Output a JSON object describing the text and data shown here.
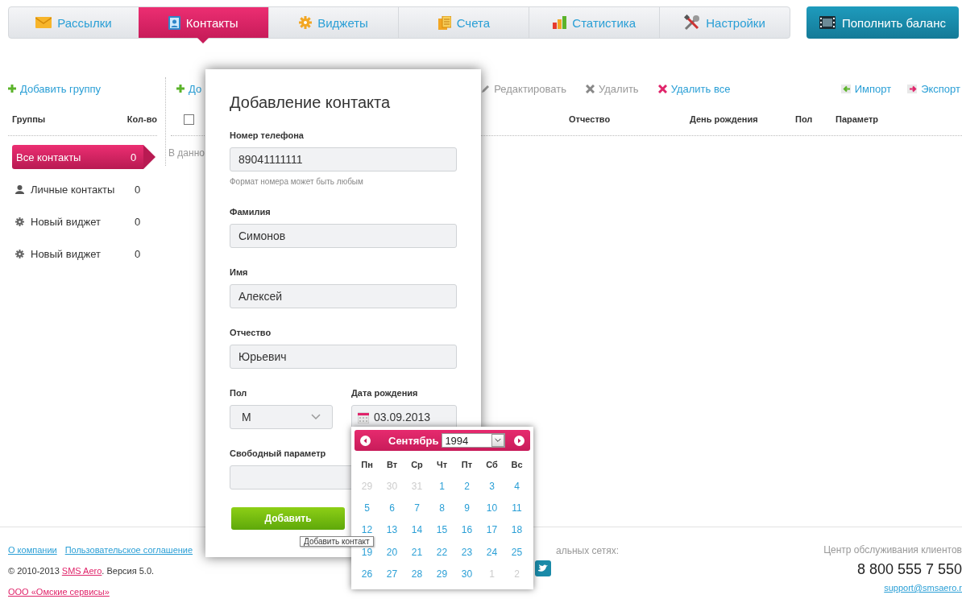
{
  "nav": {
    "tabs": [
      {
        "label": "Рассылки",
        "selected": false
      },
      {
        "label": "Контакты",
        "selected": true
      },
      {
        "label": "Виджеты",
        "selected": false
      },
      {
        "label": "Счета",
        "selected": false
      },
      {
        "label": "Статистика",
        "selected": false
      },
      {
        "label": "Настройки",
        "selected": false
      }
    ],
    "balance_button": "Пополнить баланс"
  },
  "groups": {
    "add_link": "Добавить группу",
    "columns": [
      "Группы",
      "Кол-во"
    ],
    "items": [
      {
        "kind": "all",
        "name": "Все контакты",
        "count": "0",
        "selected": true
      },
      {
        "kind": "personal",
        "name": "Личные контакты",
        "count": "0",
        "selected": false
      },
      {
        "kind": "widget",
        "name": "Новый виджет",
        "count": "0",
        "selected": false
      },
      {
        "kind": "widget",
        "name": "Новый виджет",
        "count": "0",
        "selected": false
      }
    ]
  },
  "contacts": {
    "add_link": "До",
    "toolbar": [
      {
        "kind": "edit",
        "label": "Редактировать",
        "disabled": true
      },
      {
        "kind": "delete",
        "label": "Удалить",
        "disabled": true
      },
      {
        "kind": "delete",
        "label": "Удалить все",
        "disabled": false
      }
    ],
    "io_links": [
      {
        "kind": "import",
        "label": "Импорт"
      },
      {
        "kind": "export",
        "label": "Экспорт"
      }
    ],
    "select_all_checked": false,
    "columns": [
      "Отчество",
      "День рождения",
      "Пол",
      "Параметр"
    ],
    "empty_text": "В данно"
  },
  "footer": {
    "links": [
      "О компании",
      "Пользовательское соглашение"
    ],
    "copyright": "© 2010-2013 ",
    "brand_link": "SMS Aero",
    "version": ". Версия 5.0.",
    "company_link": "ООО «Омские сервисы»",
    "social_label": "альных сетях:",
    "support_label": "Центр обслуживания клиентов",
    "phone": "8 800 555 7 550",
    "email": "support@smsaero.r"
  },
  "dialog": {
    "title": "Добавление контакта",
    "phone": {
      "label": "Номер телефона",
      "value": "89041111111",
      "hint": "Формат номера может быть любым"
    },
    "fields": [
      {
        "label": "Фамилия",
        "value": "Симонов"
      },
      {
        "label": "Имя",
        "value": "Алексей"
      },
      {
        "label": "Отчество",
        "value": "Юрьевич"
      }
    ],
    "gender": {
      "label": "Пол",
      "value": "М"
    },
    "birthday": {
      "label": "Дата рождения",
      "value": "03.09.2013"
    },
    "free_param": {
      "label": "Свободный параметр"
    },
    "submit": "Добавить"
  },
  "datepicker": {
    "month": "Сентябрь",
    "year": "1994",
    "weekdays": [
      "Пн",
      "Вт",
      "Ср",
      "Чт",
      "Пт",
      "Сб",
      "Вс"
    ],
    "weeks": [
      [
        {
          "day": "29",
          "other_month": true
        },
        {
          "day": "30",
          "other_month": true
        },
        {
          "day": "31",
          "other_month": true
        },
        {
          "day": "1",
          "other_month": false
        },
        {
          "day": "2",
          "other_month": false
        },
        {
          "day": "3",
          "other_month": false
        },
        {
          "day": "4",
          "other_month": false
        }
      ],
      [
        {
          "day": "5",
          "other_month": false
        },
        {
          "day": "6",
          "other_month": false
        },
        {
          "day": "7",
          "other_month": false
        },
        {
          "day": "8",
          "other_month": false
        },
        {
          "day": "9",
          "other_month": false
        },
        {
          "day": "10",
          "other_month": false
        },
        {
          "day": "11",
          "other_month": false
        }
      ],
      [
        {
          "day": "12",
          "other_month": false
        },
        {
          "day": "13",
          "other_month": false
        },
        {
          "day": "14",
          "other_month": false
        },
        {
          "day": "15",
          "other_month": false
        },
        {
          "day": "16",
          "other_month": false
        },
        {
          "day": "17",
          "other_month": false
        },
        {
          "day": "18",
          "other_month": false
        }
      ],
      [
        {
          "day": "19",
          "other_month": false
        },
        {
          "day": "20",
          "other_month": false
        },
        {
          "day": "21",
          "other_month": false
        },
        {
          "day": "22",
          "other_month": false
        },
        {
          "day": "23",
          "other_month": false
        },
        {
          "day": "24",
          "other_month": false
        },
        {
          "day": "25",
          "other_month": false
        }
      ],
      [
        {
          "day": "26",
          "other_month": false
        },
        {
          "day": "27",
          "other_month": false
        },
        {
          "day": "28",
          "other_month": false
        },
        {
          "day": "29",
          "other_month": false
        },
        {
          "day": "30",
          "other_month": false
        },
        {
          "day": "1",
          "other_month": true
        },
        {
          "day": "2",
          "other_month": true
        }
      ]
    ]
  },
  "tooltip": "Добавить контакт"
}
